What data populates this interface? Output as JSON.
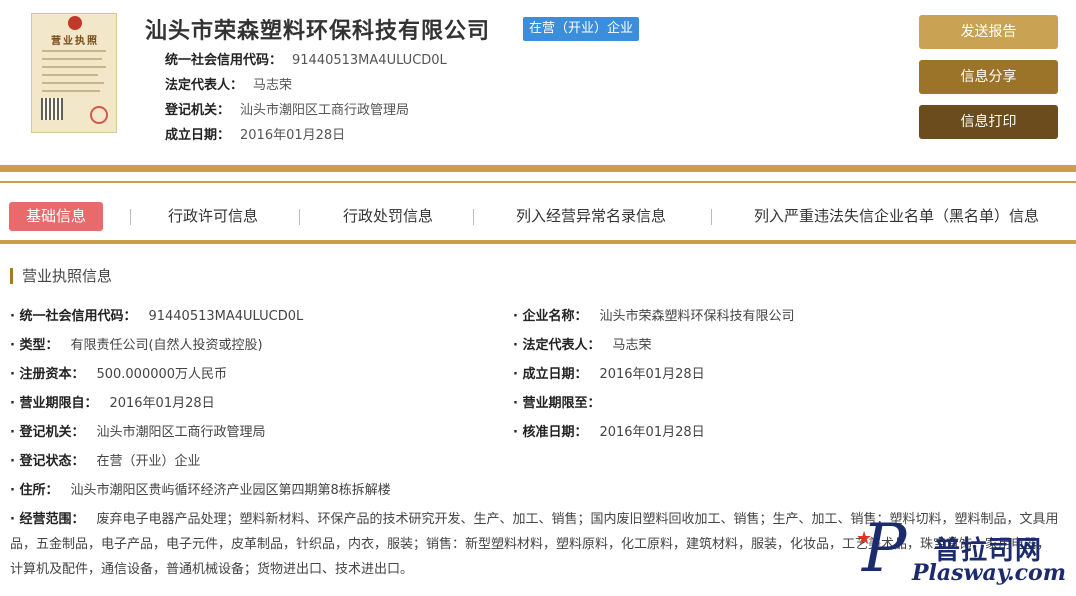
{
  "header": {
    "license_image_text": "营业执照",
    "company_name": "汕头市荣森塑料环保科技有限公司",
    "status_badge": "在营（开业）企业",
    "rows": [
      {
        "label": "统一社会信用代码：",
        "value": "91440513MA4ULUCD0L"
      },
      {
        "label": "法定代表人：",
        "value": "马志荣"
      },
      {
        "label": "登记机关：",
        "value": "汕头市潮阳区工商行政管理局"
      },
      {
        "label": "成立日期：",
        "value": "2016年01月28日"
      }
    ],
    "buttons": {
      "send_report": "发送报告",
      "share": "信息分享",
      "print": "信息打印"
    }
  },
  "tabs": [
    {
      "label": "基础信息",
      "active": true
    },
    {
      "label": "行政许可信息",
      "active": false
    },
    {
      "label": "行政处罚信息",
      "active": false
    },
    {
      "label": "列入经营异常名录信息",
      "active": false
    },
    {
      "label": "列入严重违法失信企业名单（黑名单）信息",
      "active": false
    }
  ],
  "section": {
    "title": "营业执照信息",
    "left": [
      {
        "label": "· 统一社会信用代码：",
        "value": "91440513MA4ULUCD0L"
      },
      {
        "label": "· 类型：",
        "value": "有限责任公司(自然人投资或控股)"
      },
      {
        "label": "· 注册资本：",
        "value": "500.000000万人民币"
      },
      {
        "label": "· 营业期限自：",
        "value": "2016年01月28日"
      },
      {
        "label": "· 登记机关：",
        "value": "汕头市潮阳区工商行政管理局"
      },
      {
        "label": "· 登记状态：",
        "value": "在营（开业）企业"
      },
      {
        "label": "· 住所：",
        "value": "汕头市潮阳区贵屿循环经济产业园区第四期第8栋拆解楼"
      }
    ],
    "right": [
      {
        "label": "· 企业名称：",
        "value": "汕头市荣森塑料环保科技有限公司"
      },
      {
        "label": "· 法定代表人：",
        "value": "马志荣"
      },
      {
        "label": "· 成立日期：",
        "value": "2016年01月28日"
      },
      {
        "label": "· 营业期限至：",
        "value": ""
      },
      {
        "label": "· 核准日期：",
        "value": "2016年01月28日"
      }
    ],
    "scope": {
      "label": "· 经营范围：",
      "value": "废弃电子电器产品处理；塑料新材料、环保产品的技术研究开发、生产、加工、销售；国内废旧塑料回收加工、销售；生产、加工、销售：塑料切料，塑料制品，文具用品，五金制品，电子产品，电子元件，皮革制品，针织品，内衣，服装；销售：新型塑料材料，塑料原料，化工原料，建筑材料，服装，化妆品，工艺美术品，珠宝首饰，家用电器，计算机及配件，通信设备，普通机械设备；货物进出口、技术进出口。"
    }
  },
  "watermark": {
    "cn": "普拉司网",
    "en": "Plasway.com"
  },
  "colors": {
    "gold": "#c8a04a",
    "badge_blue": "#3a8edb",
    "tab_active": "#e86a6a",
    "btn_send": "#c9a253",
    "btn_share": "#9c7429",
    "btn_print": "#6b4c1c"
  }
}
